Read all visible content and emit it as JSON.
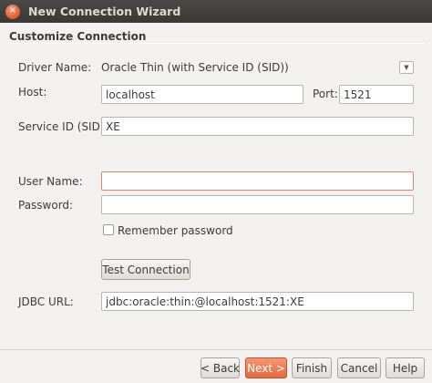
{
  "window": {
    "title": "New Connection Wizard"
  },
  "header": {
    "title": "Customize Connection"
  },
  "form": {
    "driver_name": {
      "label": "Driver Name:",
      "value": "Oracle Thin (with Service ID (SID))"
    },
    "host": {
      "label": "Host:",
      "value": "localhost"
    },
    "port": {
      "label": "Port:",
      "value": "1521"
    },
    "service_id": {
      "label": "Service ID (SID):",
      "value": "XE"
    },
    "user_name": {
      "label": "User Name:",
      "value": ""
    },
    "password": {
      "label": "Password:",
      "value": ""
    },
    "remember_password": {
      "label": "Remember password",
      "checked": false
    },
    "test_connection_label": "Test Connection",
    "jdbc_url": {
      "label": "JDBC URL:",
      "value": "jdbc:oracle:thin:@localhost:1521:XE"
    }
  },
  "buttons": {
    "back": "< Back",
    "next": "Next >",
    "finish": "Finish",
    "cancel": "Cancel",
    "help": "Help"
  },
  "colors": {
    "titlebar": "#3c3b37",
    "accent": "#e4683d",
    "focus_border": "#e08761"
  },
  "icons": {
    "close": "close-icon",
    "dropdown": "chevron-down-icon"
  }
}
